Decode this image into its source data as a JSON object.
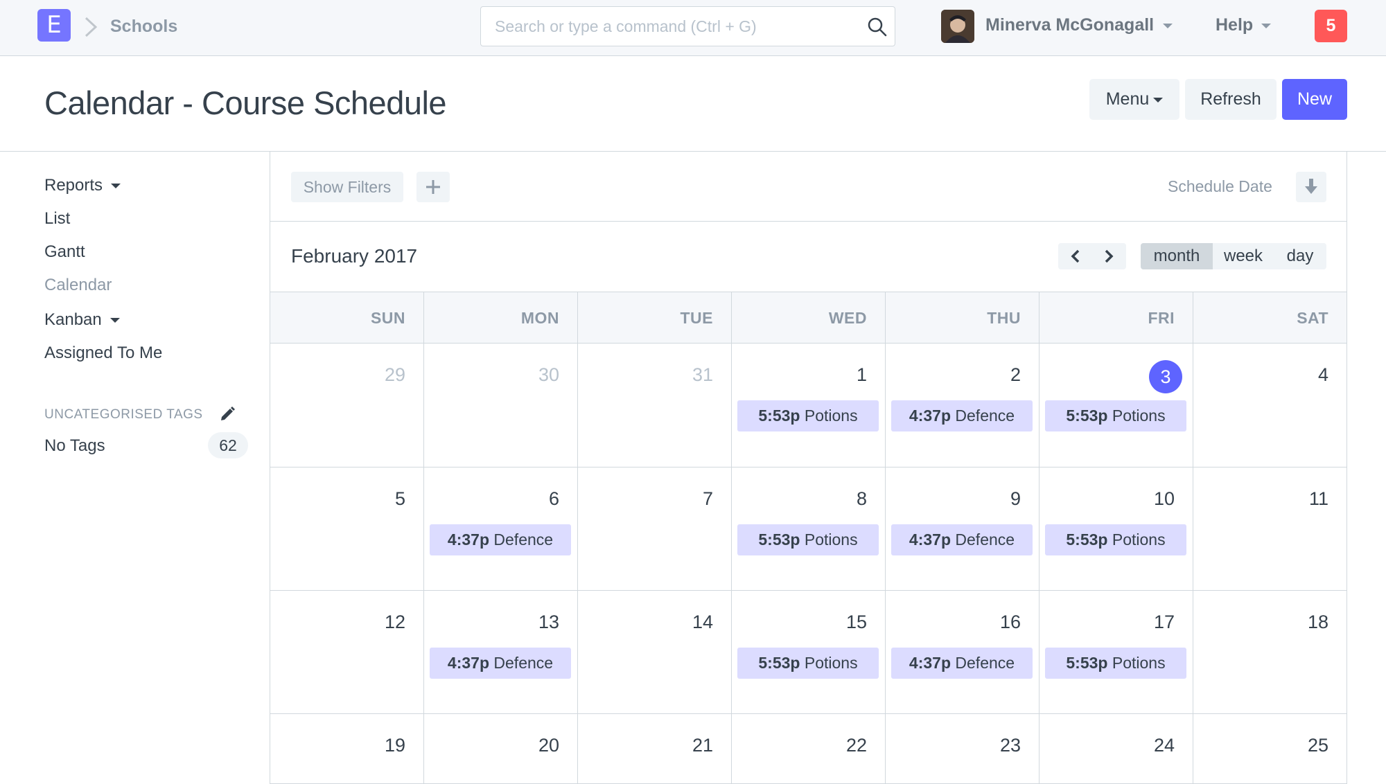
{
  "app": {
    "logo_letter": "E",
    "breadcrumb": "Schools"
  },
  "search": {
    "placeholder": "Search or type a command (Ctrl + G)",
    "value": ""
  },
  "user": {
    "name": "Minerva McGonagall",
    "help_label": "Help",
    "notification_count": "5"
  },
  "page": {
    "title": "Calendar - Course Schedule"
  },
  "actions": {
    "menu_label": "Menu",
    "refresh_label": "Refresh",
    "new_label": "New"
  },
  "sidebar": {
    "items": [
      {
        "label": "Reports",
        "dropdown": true
      },
      {
        "label": "List"
      },
      {
        "label": "Gantt"
      },
      {
        "label": "Calendar",
        "active": true
      },
      {
        "label": "Kanban",
        "dropdown": true
      },
      {
        "label": "Assigned To Me"
      }
    ],
    "tags_heading": "UNCATEGORISED TAGS",
    "no_tags_label": "No Tags",
    "no_tags_count": "62"
  },
  "filters": {
    "show_filters_label": "Show Filters",
    "sort_label": "Schedule Date"
  },
  "calendar": {
    "title": "February 2017",
    "views": [
      "month",
      "week",
      "day"
    ],
    "active_view": "month",
    "weekdays": [
      "SUN",
      "MON",
      "TUE",
      "WED",
      "THU",
      "FRI",
      "SAT"
    ],
    "today": "3",
    "weeks": [
      [
        {
          "day": "29",
          "other": true
        },
        {
          "day": "30",
          "other": true
        },
        {
          "day": "31",
          "other": true
        },
        {
          "day": "1",
          "event_time": "5:53p",
          "event_title": "Potions"
        },
        {
          "day": "2",
          "event_time": "4:37p",
          "event_title": "Defence"
        },
        {
          "day": "3",
          "event_time": "5:53p",
          "event_title": "Potions"
        },
        {
          "day": "4"
        }
      ],
      [
        {
          "day": "5"
        },
        {
          "day": "6",
          "event_time": "4:37p",
          "event_title": "Defence"
        },
        {
          "day": "7"
        },
        {
          "day": "8",
          "event_time": "5:53p",
          "event_title": "Potions"
        },
        {
          "day": "9",
          "event_time": "4:37p",
          "event_title": "Defence"
        },
        {
          "day": "10",
          "event_time": "5:53p",
          "event_title": "Potions"
        },
        {
          "day": "11"
        }
      ],
      [
        {
          "day": "12"
        },
        {
          "day": "13",
          "event_time": "4:37p",
          "event_title": "Defence"
        },
        {
          "day": "14"
        },
        {
          "day": "15",
          "event_time": "5:53p",
          "event_title": "Potions"
        },
        {
          "day": "16",
          "event_time": "4:37p",
          "event_title": "Defence"
        },
        {
          "day": "17",
          "event_time": "5:53p",
          "event_title": "Potions"
        },
        {
          "day": "18"
        }
      ],
      [
        {
          "day": "19"
        },
        {
          "day": "20"
        },
        {
          "day": "21"
        },
        {
          "day": "22"
        },
        {
          "day": "23"
        },
        {
          "day": "24"
        },
        {
          "day": "25"
        }
      ]
    ]
  },
  "colors": {
    "primary": "#5e64ff",
    "logo": "#7575ff",
    "event_bg": "#dcdcff",
    "notification": "#ff5858"
  },
  "icons": {
    "search": "search-icon",
    "chevron_breadcrumb": "chevron-right-icon",
    "pencil": "pencil-icon",
    "sort": "sort-down-icon",
    "add_filter": "plus-icon",
    "prev": "chevron-left-icon",
    "next": "chevron-right-icon"
  }
}
